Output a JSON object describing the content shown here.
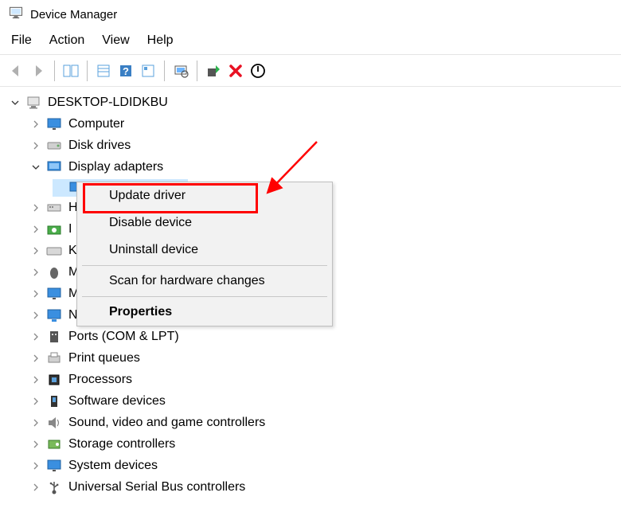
{
  "window": {
    "title": "Device Manager"
  },
  "menu": {
    "file": "File",
    "action": "Action",
    "view": "View",
    "help": "Help"
  },
  "root": "DESKTOP-LDIDKBU",
  "categories": {
    "computer": "Computer",
    "disk": "Disk drives",
    "display": "Display adapters",
    "hid": "H",
    "imaging": "I",
    "keyboards": "K",
    "mice": "M",
    "monitors": "M",
    "network": "N",
    "ports": "Ports (COM & LPT)",
    "printq": "Print queues",
    "processors": "Processors",
    "software": "Software devices",
    "sound": "Sound, video and game controllers",
    "storage": "Storage controllers",
    "system": "System devices",
    "usb": "Universal Serial Bus controllers"
  },
  "context": {
    "update": "Update driver",
    "disable": "Disable device",
    "uninstall": "Uninstall device",
    "scan": "Scan for hardware changes",
    "properties": "Properties"
  }
}
